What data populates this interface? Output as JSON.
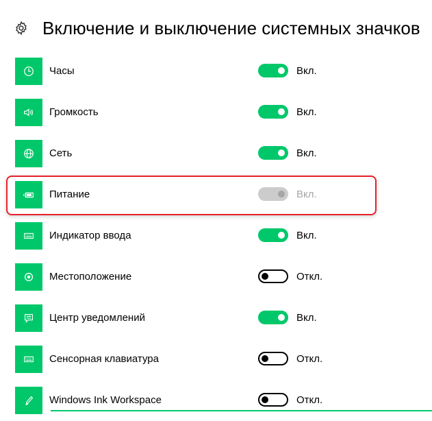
{
  "header": {
    "title": "Включение и выключение системных значков",
    "icon": "gear-icon"
  },
  "accent_color": "#00c86a",
  "highlight_color": "#e8202a",
  "items": [
    {
      "label": "Часы",
      "icon": "clock-icon",
      "state": "on",
      "state_label": "Вкл."
    },
    {
      "label": "Громкость",
      "icon": "volume-icon",
      "state": "on",
      "state_label": "Вкл."
    },
    {
      "label": "Сеть",
      "icon": "globe-icon",
      "state": "on",
      "state_label": "Вкл."
    },
    {
      "label": "Питание",
      "icon": "battery-icon",
      "state": "disabled",
      "state_label": "Вкл."
    },
    {
      "label": "Индикатор ввода",
      "icon": "keyboard-icon",
      "state": "on",
      "state_label": "Вкл."
    },
    {
      "label": "Местоположение",
      "icon": "location-icon",
      "state": "off",
      "state_label": "Откл."
    },
    {
      "label": "Центр уведомлений",
      "icon": "notification-icon",
      "state": "on",
      "state_label": "Вкл."
    },
    {
      "label": "Сенсорная клавиатура",
      "icon": "touch-keyboard-icon",
      "state": "off",
      "state_label": "Откл."
    },
    {
      "label": "Windows Ink Workspace",
      "icon": "pen-icon",
      "state": "off",
      "state_label": "Откл."
    }
  ]
}
